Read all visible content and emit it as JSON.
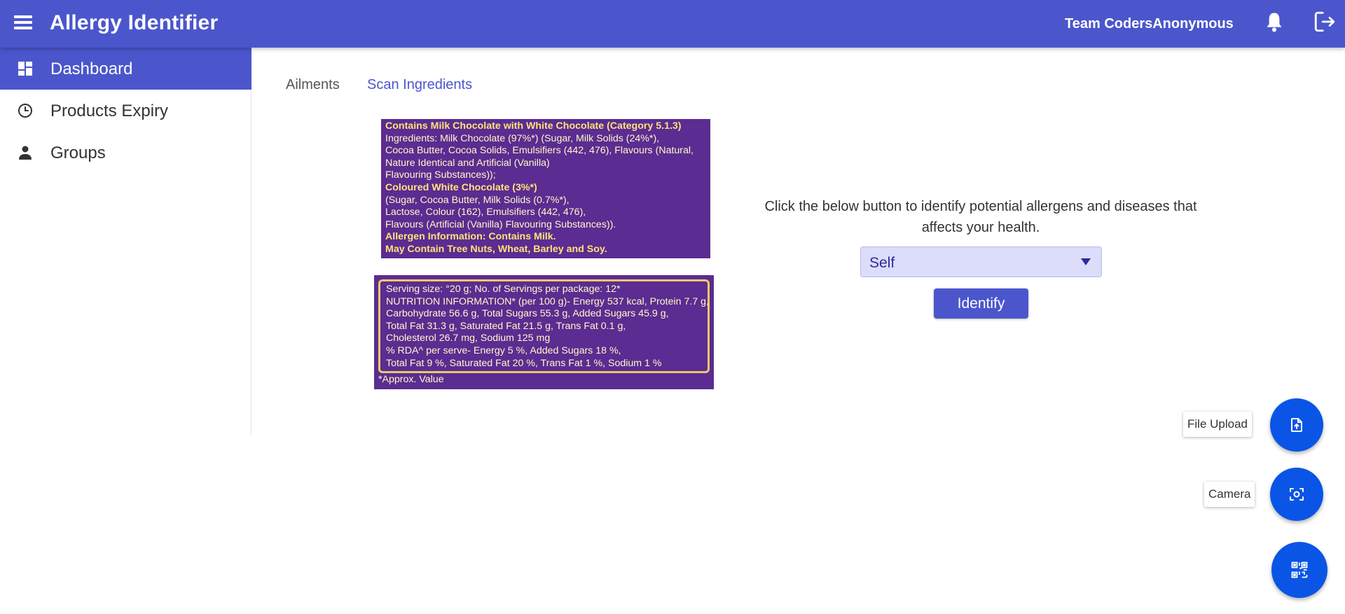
{
  "app": {
    "title": "Allergy Identifier",
    "team": "Team CodersAnonymous",
    "menu_icon": "hamburger-menu-icon",
    "notification_icon": "bell-icon",
    "logout_icon": "logout-icon",
    "brand_color": "#4b56cc",
    "fab_color": "#0a55e6"
  },
  "sidebar": {
    "items": [
      {
        "label": "Dashboard",
        "icon": "dashboard-icon",
        "active": true
      },
      {
        "label": "Products Expiry",
        "icon": "clock-icon",
        "active": false
      },
      {
        "label": "Groups",
        "icon": "person-icon",
        "active": false
      }
    ]
  },
  "tabs": [
    {
      "label": "Ailments",
      "active": false
    },
    {
      "label": "Scan Ingredients",
      "active": true
    }
  ],
  "scan_image": {
    "ingredients_lines": [
      "Contains Milk Chocolate with White Chocolate (Category 5.1.3)",
      "Ingredients: Milk Chocolate (97%*) (Sugar, Milk Solids (24%*),",
      "Cocoa Butter, Cocoa Solids, Emulsifiers (442, 476), Flavours (Natural,",
      "Nature Identical and Artificial (Vanilla)",
      "Flavouring Substances));",
      "Coloured White Chocolate (3%*)",
      "(Sugar, Cocoa Butter, Milk Solids (0.7%*),",
      "Lactose, Colour (162), Emulsifiers (442, 476),",
      "Flavours (Artificial (Vanilla) Flavouring Substances)).",
      "Allergen Information: Contains Milk.",
      "May Contain Tree Nuts, Wheat, Barley and Soy."
    ],
    "nutrition_lines": [
      "Serving size: °20 g; No. of Servings per package: 12*",
      "NUTRITION INFORMATION* (per 100 g)- Energy 537 kcal, Protein 7.7 g,",
      "Carbohydrate 56.6 g, Total Sugars 55.3 g, Added Sugars 45.9 g,",
      "Total Fat 31.3 g, Saturated Fat 21.5 g, Trans Fat 0.1 g,",
      "Cholesterol 26.7 mg, Sodium 125 mg",
      "% RDA^ per serve- Energy 5 %, Added Sugars 18 %,",
      "Total Fat 9 %, Saturated Fat 20 %, Trans Fat 1 %, Sodium 1 %"
    ],
    "footnote": "*Approx. Value"
  },
  "identify": {
    "prompt": "Click the below button to identify potential allergens and diseases that affects your health.",
    "select_value": "Self",
    "button_label": "Identify"
  },
  "fabs": {
    "upload_tooltip": "File Upload",
    "camera_tooltip": "Camera",
    "upload_icon": "file-upload-icon",
    "camera_icon": "camera-scan-icon",
    "main_icon": "qr-code-icon"
  }
}
